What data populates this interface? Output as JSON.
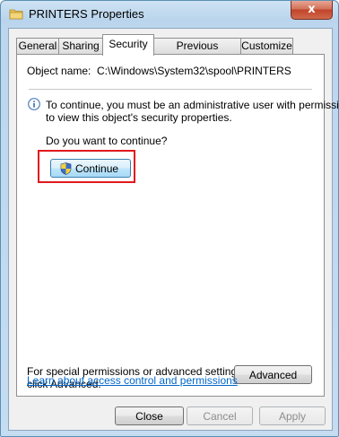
{
  "window": {
    "title": "PRINTERS Properties",
    "close_glyph": "x"
  },
  "tabs": [
    {
      "label": "General"
    },
    {
      "label": "Sharing"
    },
    {
      "label": "Security",
      "active": true
    },
    {
      "label": "Previous Versions"
    },
    {
      "label": "Customize"
    }
  ],
  "security": {
    "object_name_label": "Object name:",
    "object_name_value": "C:\\Windows\\System32\\spool\\PRINTERS",
    "info_line1": "To continue, you must be an administrative user with permission",
    "info_line2": "to view this object's security properties.",
    "question": "Do you want to continue?",
    "continue_button": "Continue",
    "advanced_text_line1": "For special permissions or advanced settings,",
    "advanced_text_line2": "click Advanced.",
    "advanced_button": "Advanced",
    "learn_link": "Learn about access control and permissions"
  },
  "footer": {
    "close_button": "Close",
    "cancel_button": "Cancel",
    "apply_button": "Apply"
  },
  "icons": {
    "title": "folder-icon",
    "info": "info-icon",
    "shield": "uac-shield-icon"
  }
}
